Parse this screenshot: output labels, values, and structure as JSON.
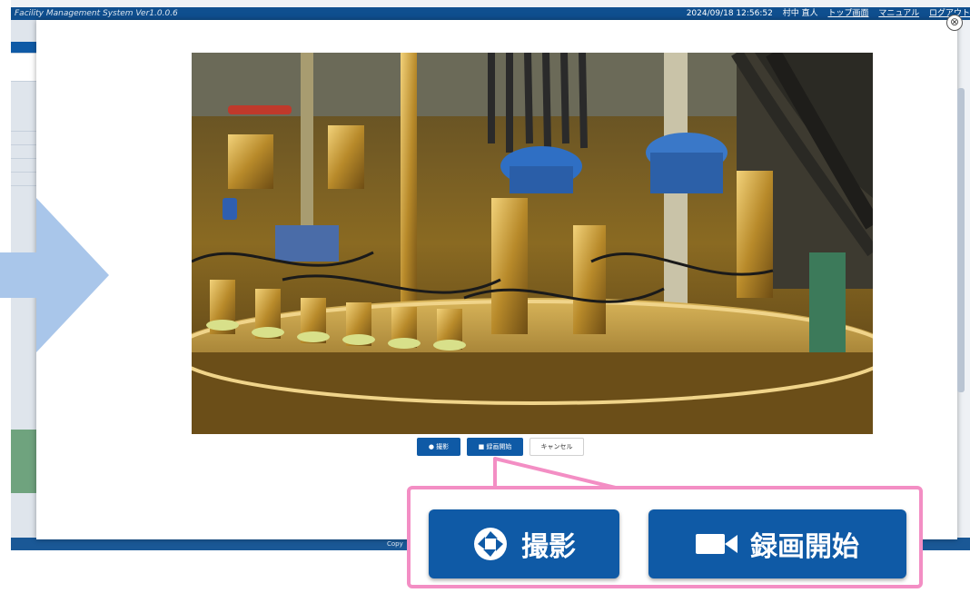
{
  "app": {
    "title": "Facility Management System  Ver1.0.0.6",
    "datetime": "2024/09/18 12:56:52",
    "user": "村中 直人",
    "links": [
      "トップ画面",
      "マニュアル",
      "ログアウト"
    ],
    "footer": "Copy"
  },
  "modal": {
    "close_label": "⊗",
    "buttons": {
      "capture": "撮影",
      "record": "録画開始",
      "cancel": "キャンセル"
    }
  },
  "callout": {
    "capture": "撮影",
    "record": "録画開始"
  },
  "icons": {
    "capture": "camera-shutter-icon",
    "record": "video-camera-icon",
    "close": "close-icon",
    "arrow": "arrow-right-icon"
  },
  "colors": {
    "header": "#0f4f8f",
    "button": "#0f5aa6",
    "callout_border": "#f38ec4",
    "arrow": "#a9c6ea"
  }
}
